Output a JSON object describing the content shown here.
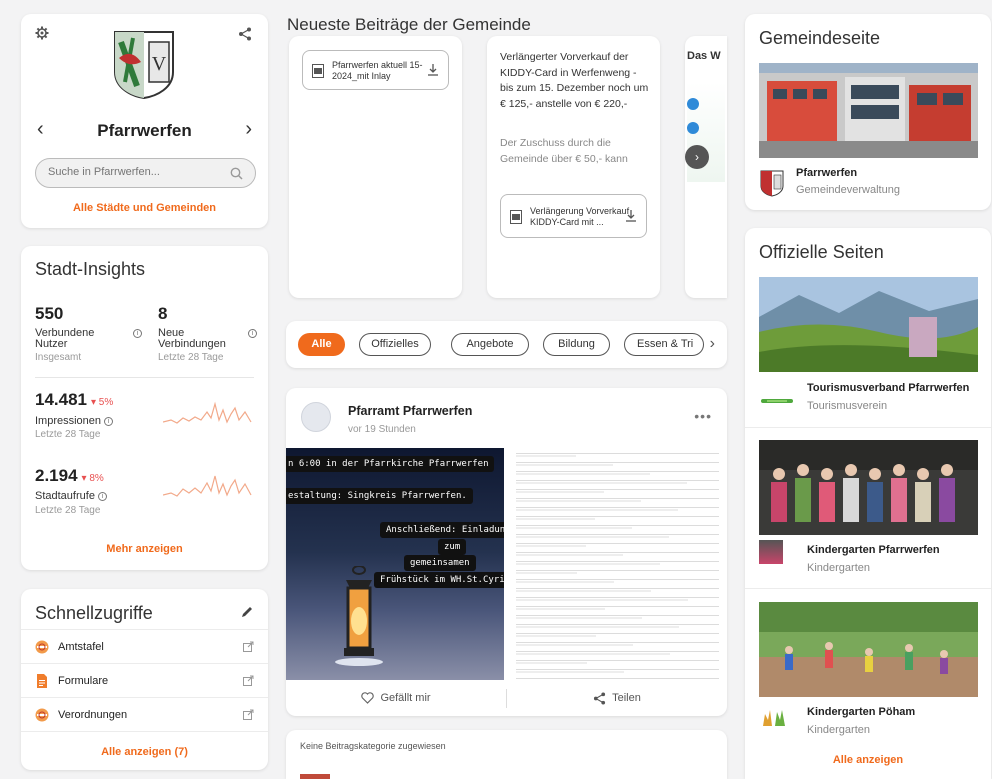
{
  "city": {
    "name": "Pfarrwerfen",
    "search_placeholder": "Suche in Pfarrwerfen...",
    "all_cities_link": "Alle Städte und Gemeinden"
  },
  "insights": {
    "title": "Stadt-Insights",
    "users_value": "550",
    "users_label_1": "Verbundene",
    "users_label_2": "Nutzer",
    "users_sub": "Insgesamt",
    "conn_value": "8",
    "conn_label_1": "Neue",
    "conn_label_2": "Verbindungen",
    "conn_sub": "Letzte 28 Tage",
    "impressions_value": "14.481",
    "impressions_delta": "▾ 5%",
    "impressions_label": "Impressionen",
    "impressions_sub": "Letzte 28 Tage",
    "visits_value": "2.194",
    "visits_delta": "▾ 8%",
    "visits_label": "Stadtaufrufe",
    "visits_sub": "Letzte 28 Tage",
    "more_link": "Mehr anzeigen"
  },
  "quick": {
    "title": "Schnellzugriffe",
    "items": [
      {
        "label": "Amtstafel",
        "icon": "municipal-seal-icon"
      },
      {
        "label": "Formulare",
        "icon": "document-icon"
      },
      {
        "label": "Verordnungen",
        "icon": "municipal-seal-icon"
      }
    ],
    "all_link": "Alle anzeigen (7)"
  },
  "news": {
    "title": "Neueste Beiträge der Gemeinde",
    "doc1_attachment": "Pfarrwerfen aktuell 15-2024_mit Inlay",
    "doc2_text": "Verlängerter Vorverkauf der KIDDY-Card in Werfenweng - bis zum 15. Dezember noch um € 125,- anstelle von € 220,-",
    "doc2_fade": "Der Zuschuss durch die Gemeinde über € 50,- kann",
    "doc2_attachment": "Verlängerung Vorverkauf KIDDY-Card mit ...",
    "doc3_text": "Das W"
  },
  "filters": {
    "chips": [
      "Alle",
      "Offizielles",
      "Angebote",
      "Bildung",
      "Essen & Tri"
    ],
    "active": "Alle"
  },
  "post": {
    "author": "Pfarramt Pfarrwerfen",
    "time": "vor 19 Stunden",
    "pic_line1": "n 6:00 in der Pfarrkirche Pfarrwerfen",
    "pic_line2": "estaltung: Singkreis Pfarrwerfen.",
    "pic_line3": "Anschließend: Einladung",
    "pic_line4": "zum",
    "pic_line5": "gemeinsamen",
    "pic_line6": "Frühstück im WH.St.Cyriak",
    "like_label": "Gefällt mir",
    "share_label": "Teilen"
  },
  "nocat": {
    "text": "Keine Beitragskategorie zugewiesen"
  },
  "gemeinde": {
    "title": "Gemeindeseite",
    "name": "Pfarrwerfen",
    "type": "Gemeindeverwaltung"
  },
  "official": {
    "title": "Offizielle Seiten",
    "pages": [
      {
        "name": "Tourismusverband Pfarrwerfen",
        "type": "Tourismusverein"
      },
      {
        "name": "Kindergarten Pfarrwerfen",
        "type": "Kindergarten"
      },
      {
        "name": "Kindergarten Pöham",
        "type": "Kindergarten"
      }
    ],
    "all_link": "Alle anzeigen"
  },
  "colors": {
    "accent": "#f06a1c",
    "negative": "#e85050",
    "sparkline": "#f2a98a"
  }
}
